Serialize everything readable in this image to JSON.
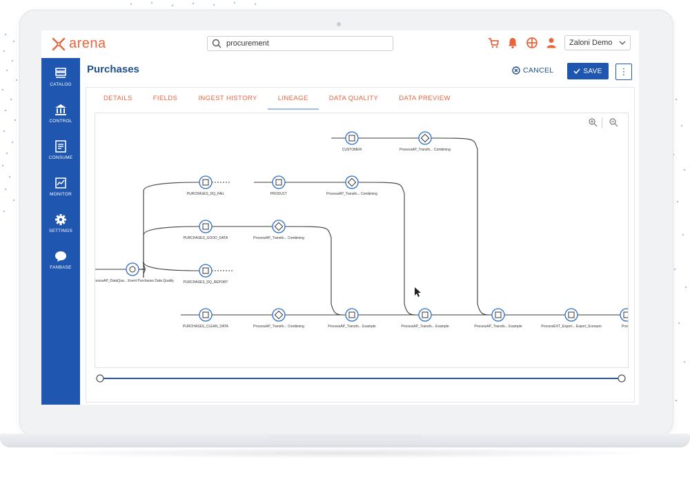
{
  "app": {
    "name": "arena",
    "accent": "#e8643c",
    "brand_blue": "#1f56b0"
  },
  "search": {
    "value": "procurement"
  },
  "user": {
    "label": "Zaloni Demo"
  },
  "top_icons": [
    "cart-icon",
    "bell-icon",
    "lifebuoy-icon",
    "user-icon"
  ],
  "sidebar": {
    "items": [
      {
        "label": "CATALOG",
        "icon": "catalog-icon"
      },
      {
        "label": "CONTROL",
        "icon": "control-icon"
      },
      {
        "label": "CONSUME",
        "icon": "consume-icon"
      },
      {
        "label": "MONITOR",
        "icon": "monitor-icon"
      },
      {
        "label": "SETTINGS",
        "icon": "gear-icon"
      },
      {
        "label": "FANBASE",
        "icon": "chat-icon"
      }
    ]
  },
  "page": {
    "title": "Purchases"
  },
  "actions": {
    "cancel": "CANCEL",
    "save": "SAVE",
    "more": "⋮"
  },
  "tabs": [
    "DETAILS",
    "FIELDS",
    "INGEST HISTORY",
    "LINEAGE",
    "DATA QUALITY",
    "DATA PREVIEW"
  ],
  "active_tab": "LINEAGE",
  "lineage": {
    "nodes": [
      {
        "id": "n1",
        "label": "ProcessAP_DataQua... Event Purchases Data Quality",
        "icon": "q"
      },
      {
        "id": "n2",
        "label": "PURCHASES_DQ_FAIL",
        "icon": "t"
      },
      {
        "id": "n3",
        "label": "PURCHASES_GOOD_DATA",
        "icon": "t"
      },
      {
        "id": "n4",
        "label": "PURCHASES_DQ_REPORT",
        "icon": "t"
      },
      {
        "id": "n5",
        "label": "PURCHASES_CLEAN_DATA",
        "icon": "t"
      },
      {
        "id": "n6",
        "label": "ProcessAP_Transfo... Combining",
        "icon": "p"
      },
      {
        "id": "n7",
        "label": "ProcessAP_Transfo... Combining",
        "icon": "p"
      },
      {
        "id": "n8",
        "label": "PRODUCT",
        "icon": "t"
      },
      {
        "id": "n9",
        "label": "ProcessAP_Transfo... Combining",
        "icon": "p"
      },
      {
        "id": "n10",
        "label": "CUSTOMER",
        "icon": "t"
      },
      {
        "id": "n11",
        "label": "ProcessAP_Transfo... Combining",
        "icon": "p"
      },
      {
        "id": "n12",
        "label": "ProcessAP_Transfo... Example",
        "icon": "j"
      },
      {
        "id": "n13",
        "label": "ProcessAP_Transfo... Example",
        "icon": "j"
      },
      {
        "id": "n14",
        "label": "ProcessAP_Transfo... Example",
        "icon": "j"
      },
      {
        "id": "n15",
        "label": "ProcessEXT_Export... Export_Scenario",
        "icon": "j"
      },
      {
        "id": "n16",
        "label": "Proc...",
        "icon": "t"
      }
    ]
  }
}
